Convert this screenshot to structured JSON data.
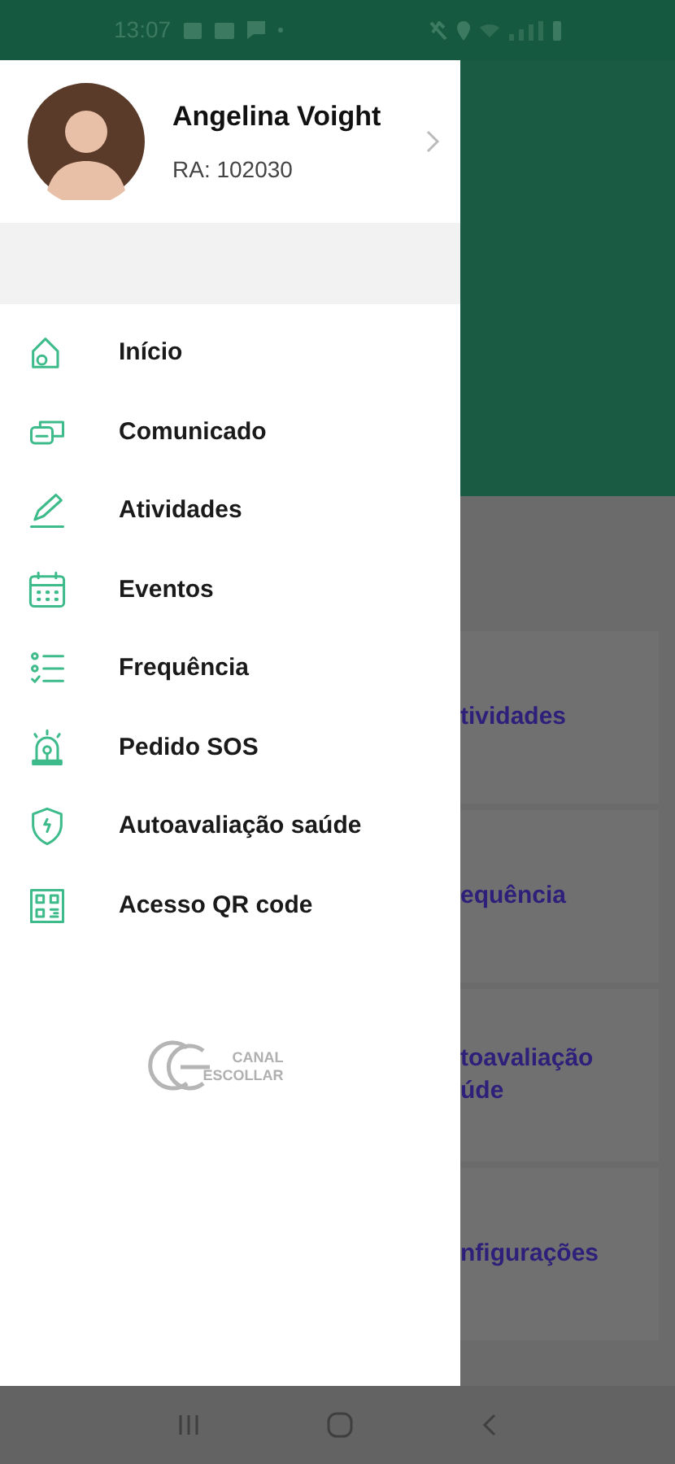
{
  "status_bar": {
    "time": "13:07"
  },
  "profile": {
    "name": "Angelina Voight",
    "ra": "RA: 102030"
  },
  "menu": [
    {
      "label": "Início",
      "kind": "home"
    },
    {
      "label": "Comunicado",
      "kind": "chat"
    },
    {
      "label": "Atividades",
      "kind": "pencil"
    },
    {
      "label": "Eventos",
      "kind": "calendar"
    },
    {
      "label": "Frequência",
      "kind": "checklist"
    },
    {
      "label": "Pedido SOS",
      "kind": "siren"
    },
    {
      "label": "Autoavaliação saúde",
      "kind": "shield"
    },
    {
      "label": "Acesso QR code",
      "kind": "qr"
    }
  ],
  "logo": {
    "lines": [
      "CANAL",
      "ESCOLLAR"
    ]
  },
  "background_cards": [
    {
      "lines": [
        "tividades"
      ]
    },
    {
      "lines": [
        "equência"
      ]
    },
    {
      "lines": [
        "toavaliação",
        "úde"
      ]
    },
    {
      "lines": [
        "nfigurações"
      ]
    }
  ]
}
